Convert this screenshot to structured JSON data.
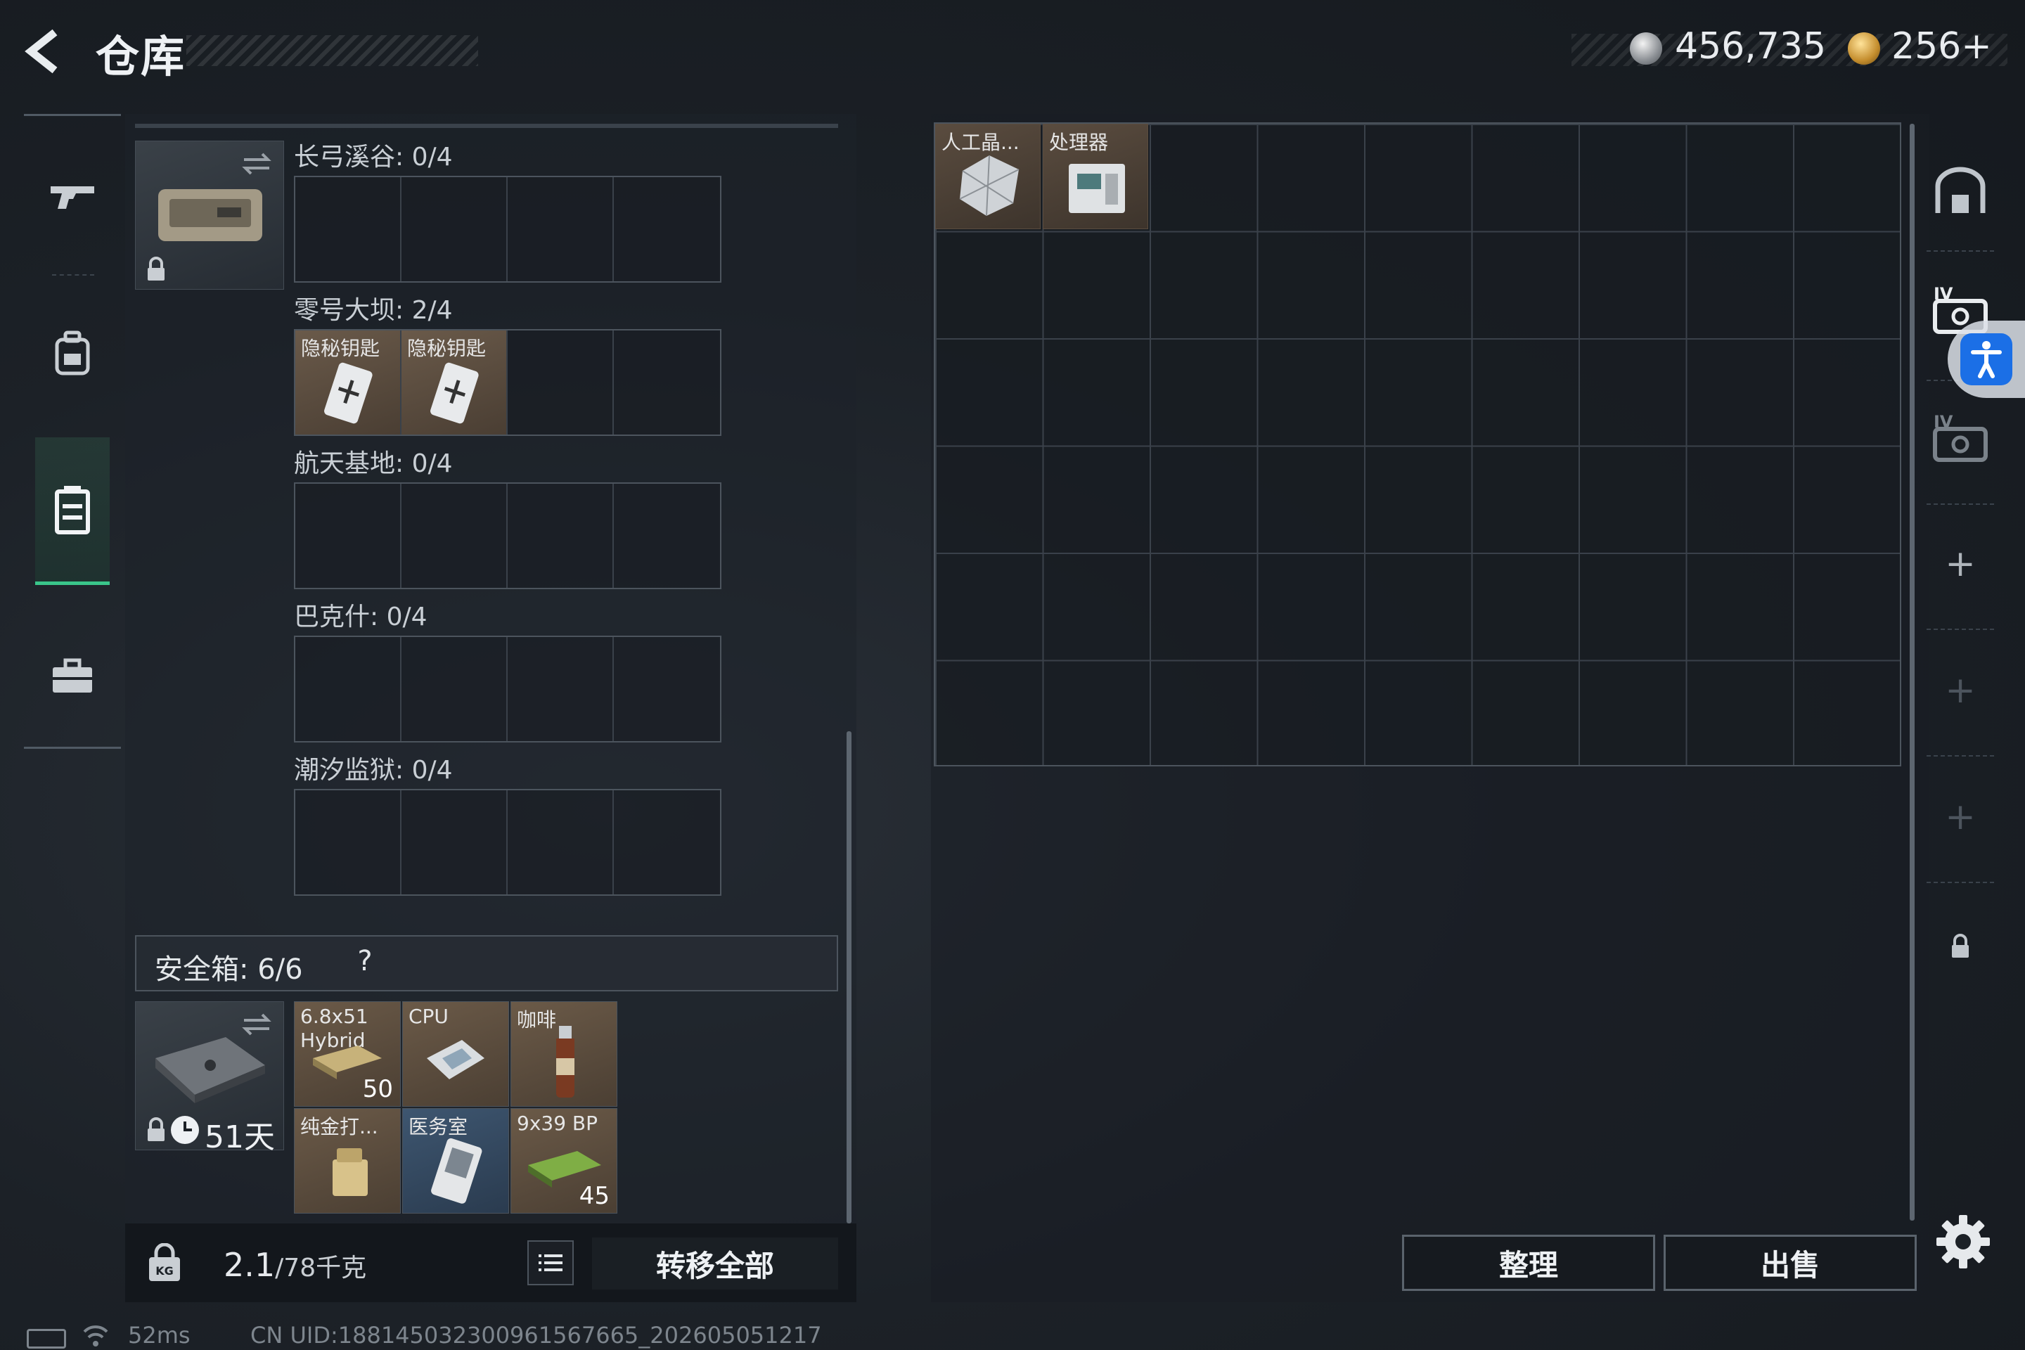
{
  "header": {
    "title": "仓库",
    "currency": [
      {
        "name": "silver-coin-icon",
        "value": "456,735",
        "color": "#b9bcc0"
      },
      {
        "name": "gold-coin-icon",
        "value": "256+",
        "color": "#d9a23a"
      }
    ]
  },
  "left_nav": {
    "items": [
      {
        "icon": "gun-icon",
        "active": false
      },
      {
        "icon": "backpack-icon",
        "active": false
      },
      {
        "icon": "chest-rig-icon",
        "active": true
      },
      {
        "icon": "toolbox-icon",
        "active": false
      }
    ],
    "accent": "#3ac58a"
  },
  "key_case": {
    "sections": [
      {
        "label": "长弓溪谷: 0/4",
        "items": []
      },
      {
        "label": "零号大坝: 2/4",
        "items": [
          "隐秘钥匙",
          "隐秘钥匙"
        ]
      },
      {
        "label": "航天基地: 0/4",
        "items": []
      },
      {
        "label": "巴克什: 0/4",
        "items": []
      },
      {
        "label": "潮汐监狱: 0/4",
        "items": []
      }
    ]
  },
  "safe_box": {
    "label": "安全箱: 6/6",
    "help": "?",
    "timer": "51天",
    "items": [
      {
        "label": "6.8x51 Hybrid",
        "count": "50",
        "style": "brown"
      },
      {
        "label": "CPU",
        "count": "",
        "style": "brown"
      },
      {
        "label": "咖啡",
        "count": "",
        "style": "brown"
      },
      {
        "label": "纯金打...",
        "count": "",
        "style": "brown"
      },
      {
        "label": "医务室",
        "count": "",
        "style": "blue"
      },
      {
        "label": "9x39 BP",
        "count": "45",
        "style": "brown"
      }
    ]
  },
  "bottom_left": {
    "weight_value": "2.1",
    "weight_capacity": "/78千克",
    "transfer_all": "转移全部"
  },
  "stash": {
    "items": [
      {
        "label": "人工晶..."
      },
      {
        "label": "处理器"
      }
    ]
  },
  "right_rail": {
    "tier_label_1": "IV",
    "tier_label_2": "IV"
  },
  "actions": {
    "sort": "整理",
    "sell": "出售"
  },
  "status": {
    "ping": "52ms",
    "uid": "CN UID:18814503230096156​7665_202605051217"
  }
}
